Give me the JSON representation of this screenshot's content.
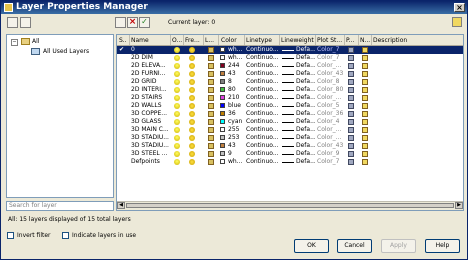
{
  "window": {
    "title": "Layer Properties Manager"
  },
  "toolbar": {
    "current_layer": "Current layer: 0"
  },
  "tree": {
    "root_label": "All",
    "child_label": "All Used Layers"
  },
  "search": {
    "placeholder": "Search for layer"
  },
  "columns": [
    "S..",
    "Name",
    "O...",
    "Fre...",
    "L...",
    "Color",
    "Linetype",
    "Lineweight",
    "Plot St...",
    "P...",
    "N...",
    "Description"
  ],
  "layers": [
    {
      "status": "✔",
      "name": "0",
      "color": "wh...",
      "swatch": "#ffffff",
      "linetype": "Continuo...",
      "lineweight": "Defa...",
      "plot": "Color_7",
      "selected": true
    },
    {
      "status": "",
      "name": "2D DIM",
      "color": "wh...",
      "swatch": "#ffffff",
      "linetype": "Continuo...",
      "lineweight": "Defa...",
      "plot": "Color_7"
    },
    {
      "status": "",
      "name": "2D ELEVA...",
      "color": "244",
      "swatch": "#800020",
      "linetype": "Continuo...",
      "lineweight": "Defa...",
      "plot": "Color_..."
    },
    {
      "status": "",
      "name": "2D FURNI...",
      "color": "43",
      "swatch": "#c08040",
      "linetype": "Continuo...",
      "lineweight": "Defa...",
      "plot": "Color_43"
    },
    {
      "status": "",
      "name": "2D GRID",
      "color": "8",
      "swatch": "#808080",
      "linetype": "Continuo...",
      "lineweight": "Defa...",
      "plot": "Color_8"
    },
    {
      "status": "",
      "name": "2D INTERI...",
      "color": "80",
      "swatch": "#40c040",
      "linetype": "Continuo...",
      "lineweight": "Defa...",
      "plot": "Color_80"
    },
    {
      "status": "",
      "name": "2D STAIRS",
      "color": "210",
      "swatch": "#e040e0",
      "linetype": "Continuo...",
      "lineweight": "Defa...",
      "plot": "Color_..."
    },
    {
      "status": "",
      "name": "2D WALLS",
      "color": "blue",
      "swatch": "#0000ff",
      "linetype": "Continuo...",
      "lineweight": "Defa...",
      "plot": "Color_5"
    },
    {
      "status": "",
      "name": "3D COPPE...",
      "color": "36",
      "swatch": "#c08000",
      "linetype": "Continuo...",
      "lineweight": "Defa...",
      "plot": "Color_36"
    },
    {
      "status": "",
      "name": "3D GLASS",
      "color": "cyan",
      "swatch": "#00ffff",
      "linetype": "Continuo...",
      "lineweight": "Defa...",
      "plot": "Color_4"
    },
    {
      "status": "",
      "name": "3D MAIN C...",
      "color": "255",
      "swatch": "#ffffff",
      "linetype": "Continuo...",
      "lineweight": "Defa...",
      "plot": "Color_..."
    },
    {
      "status": "",
      "name": "3D STADIU...",
      "color": "253",
      "swatch": "#c0c0c0",
      "linetype": "Continuo...",
      "lineweight": "Defa...",
      "plot": "Color_..."
    },
    {
      "status": "",
      "name": "3D STADIU...",
      "color": "43",
      "swatch": "#c08040",
      "linetype": "Continuo...",
      "lineweight": "Defa...",
      "plot": "Color_43"
    },
    {
      "status": "",
      "name": "3D STEEL ...",
      "color": "9",
      "swatch": "#c0c0c0",
      "linetype": "Continuo...",
      "lineweight": "Defa...",
      "plot": "Color_9"
    },
    {
      "status": "",
      "name": "Defpoints",
      "color": "wh...",
      "swatch": "#ffffff",
      "linetype": "Continuo...",
      "lineweight": "Defa...",
      "plot": "Color_7"
    }
  ],
  "status": {
    "text": "All: 15 layers displayed of 15 total layers"
  },
  "options": {
    "invert_filter": "Invert filter",
    "indicate_in_use": "Indicate layers in use"
  },
  "buttons": {
    "ok": "OK",
    "cancel": "Cancel",
    "apply": "Apply",
    "help": "Help"
  }
}
